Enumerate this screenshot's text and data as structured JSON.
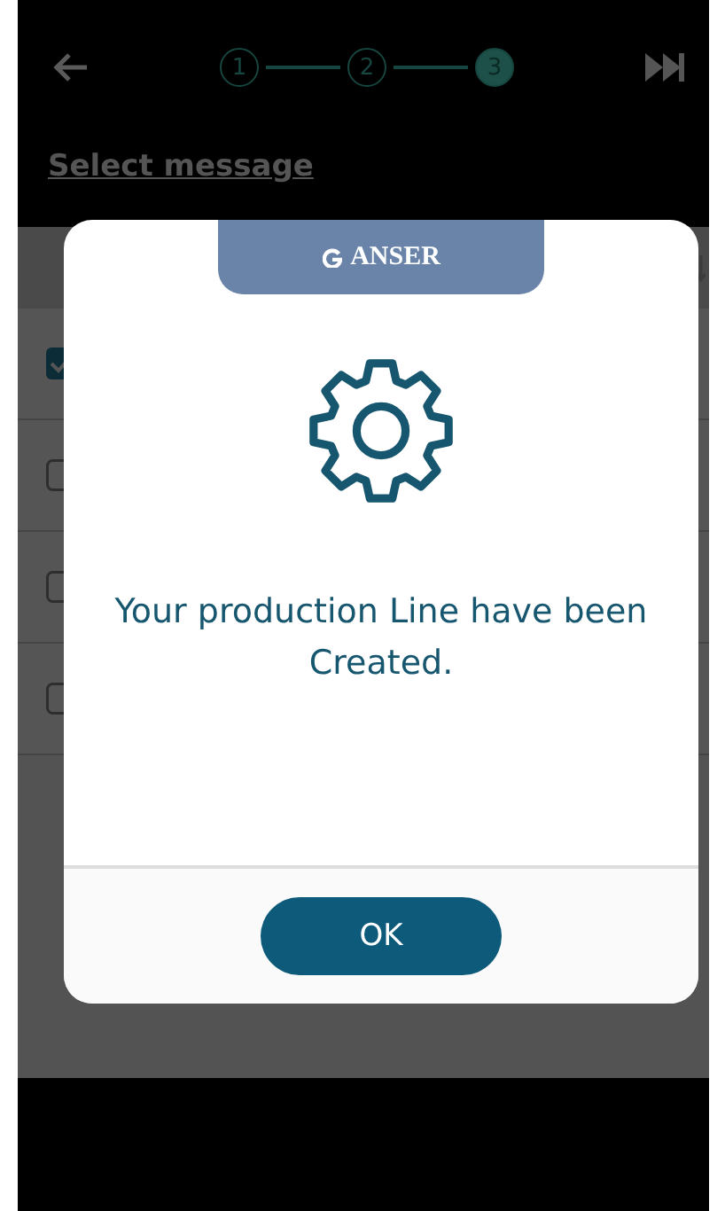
{
  "top_bar": {
    "steps": [
      {
        "label": "1",
        "selected": false
      },
      {
        "label": "2",
        "selected": false
      },
      {
        "label": "3",
        "selected": true
      }
    ]
  },
  "section": {
    "title": "Select message"
  },
  "rows": [
    {
      "checked": true
    },
    {
      "checked": false
    },
    {
      "checked": false
    },
    {
      "checked": false
    }
  ],
  "dialog": {
    "brand": "ANSER",
    "message": "Your production Line have been Created.",
    "button": "OK"
  }
}
